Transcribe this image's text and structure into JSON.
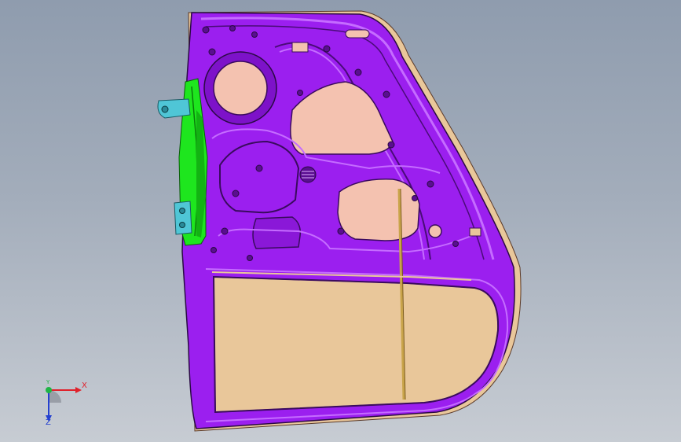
{
  "viewport": {
    "background_top": "#8f9cae",
    "background_bottom": "#c7ccd3"
  },
  "model": {
    "part": "door-inner-panel",
    "panel_color": "#9b1fef",
    "panel_edge_color": "#2a0a44",
    "opening_color": "#f4c2b0",
    "hinge_bracket_color": "#1ee61e",
    "hinge_plate_color": "#4fc6d6",
    "guide_rail_color": "#c9a44a",
    "trim_color": "#e9c79a"
  },
  "triad": {
    "x_label": "X",
    "y_label": "Y",
    "z_label": "Z",
    "x_color": "#e0202a",
    "y_color": "#1fb545",
    "z_color": "#2440d0"
  }
}
